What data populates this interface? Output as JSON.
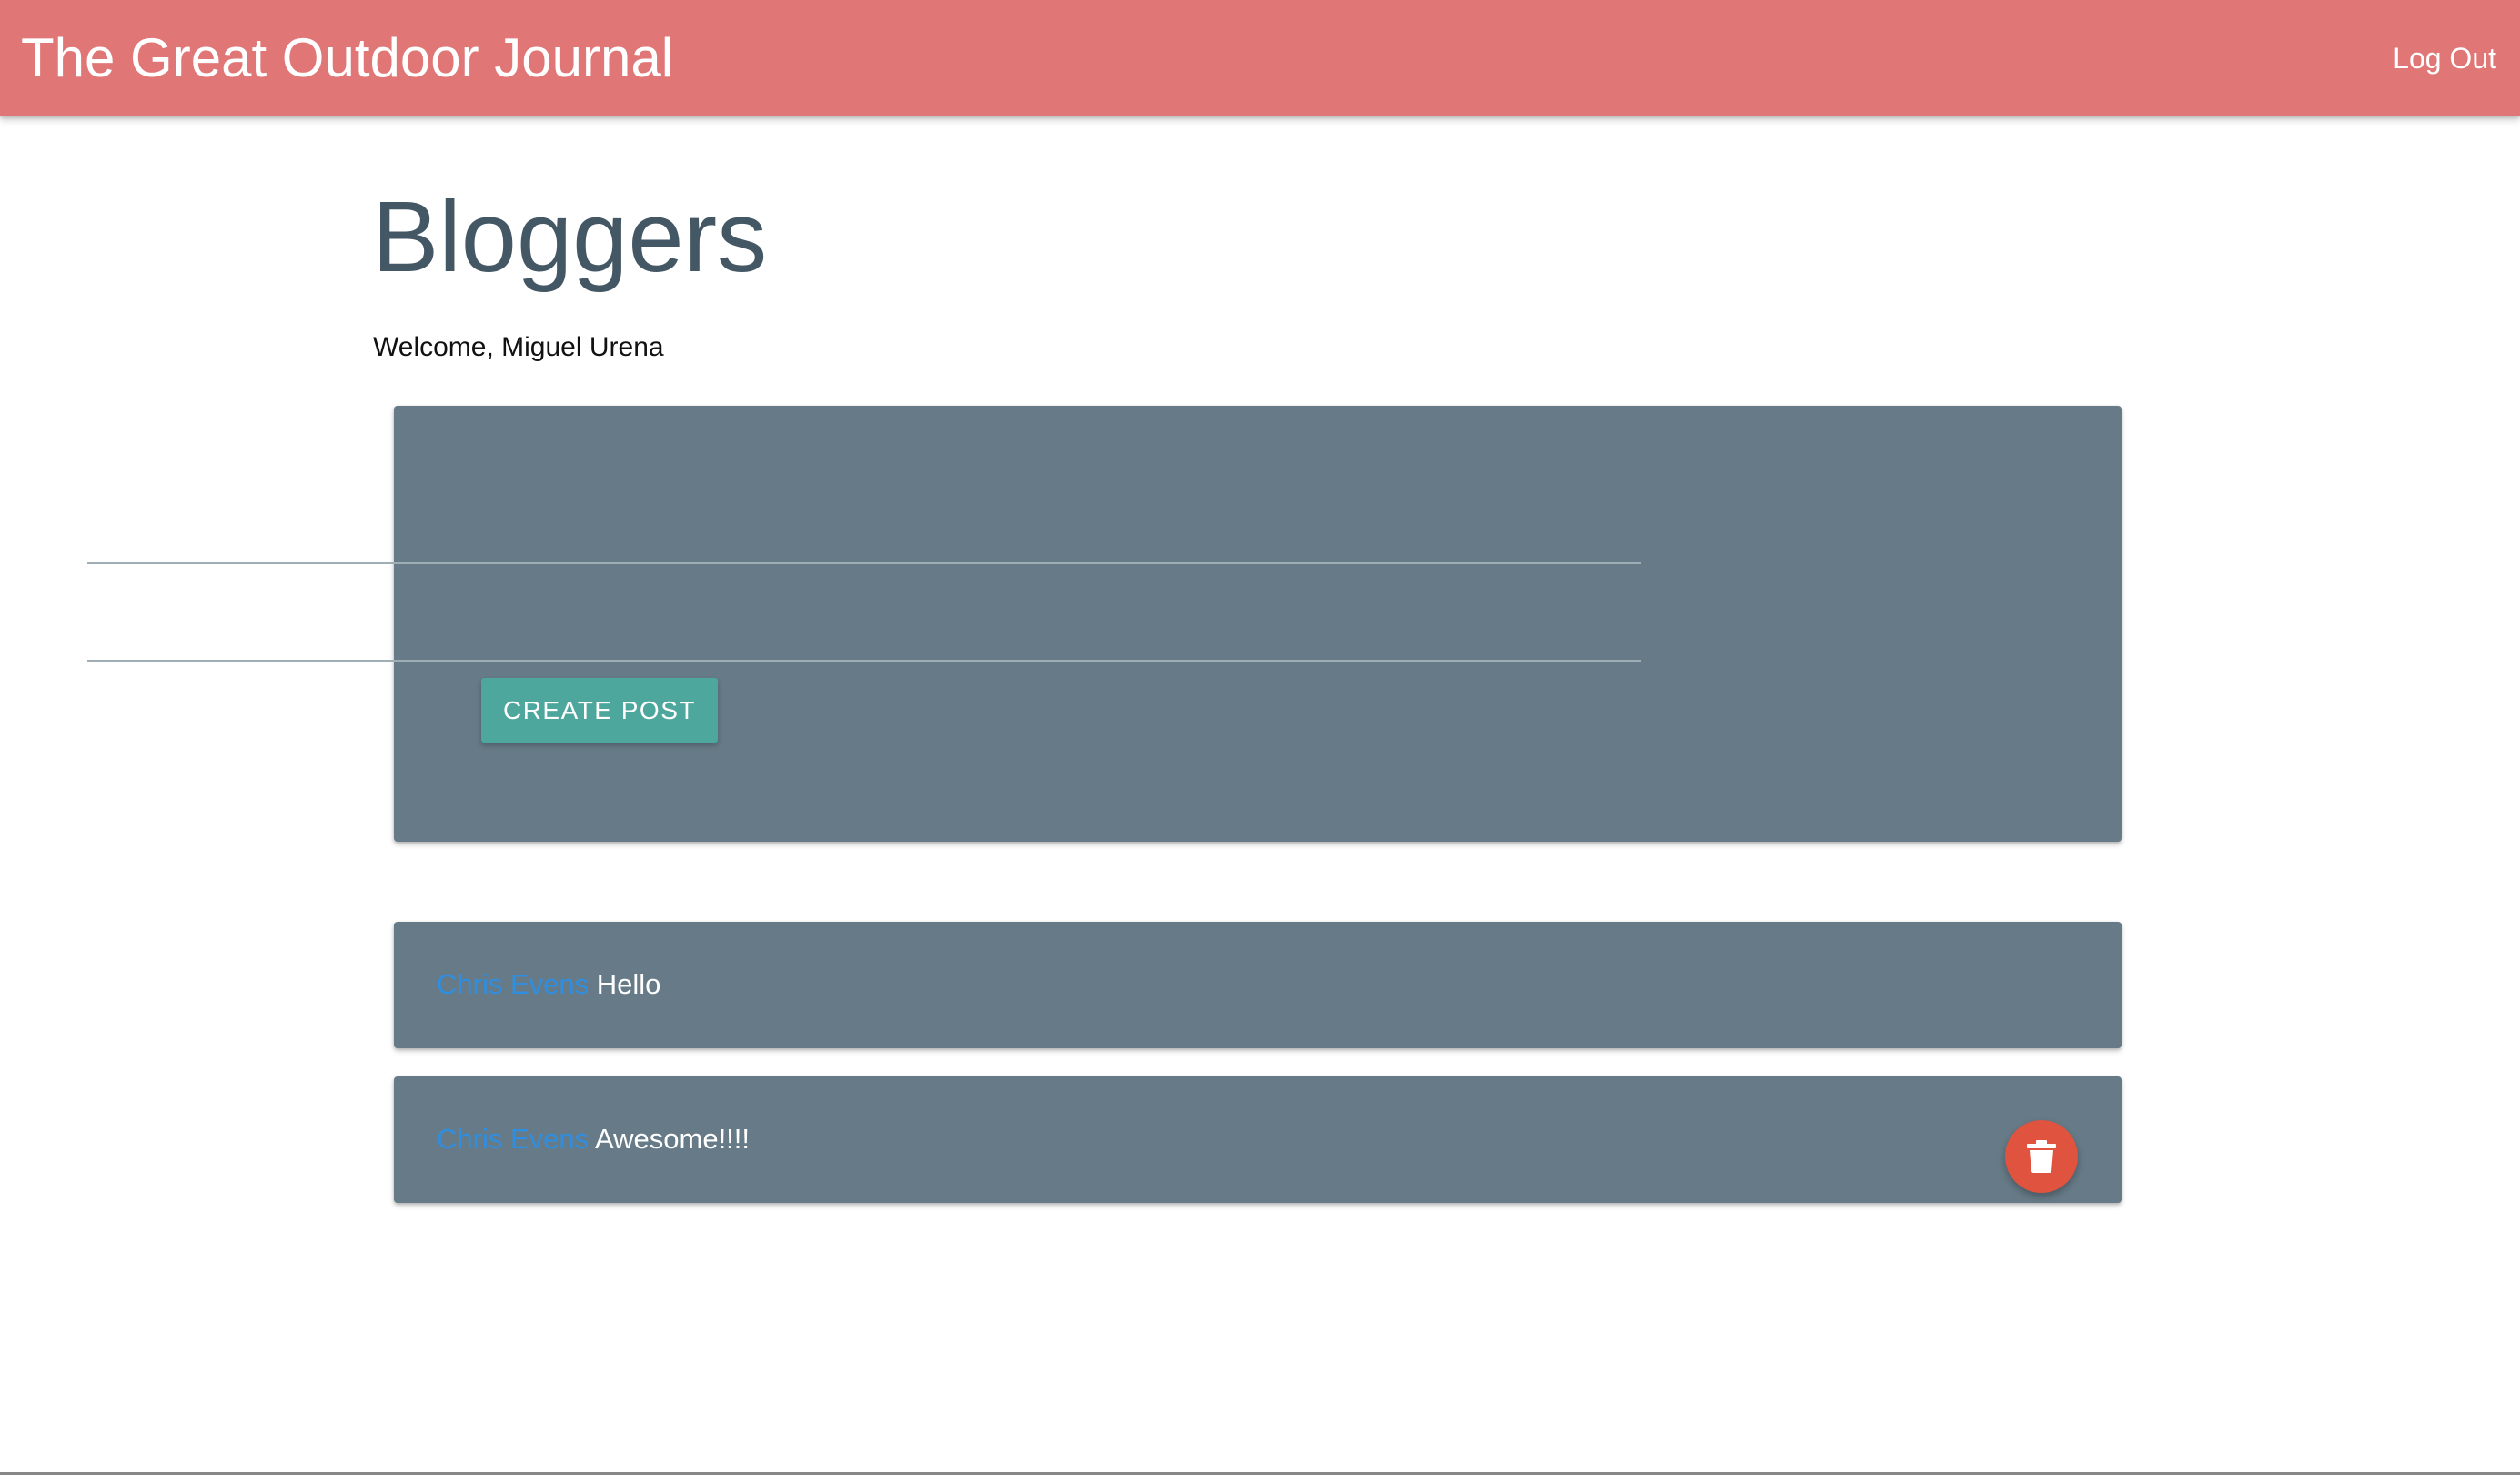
{
  "app": {
    "brand": "The Great Outdoor Journal",
    "logout_label": "Log Out"
  },
  "page": {
    "title": "Bloggers",
    "welcome": "Welcome, Miguel Urena"
  },
  "form": {
    "title_value": "",
    "body_value": "",
    "create_label": "CREATE POST"
  },
  "posts": [
    {
      "author": "Chris Evens",
      "text": "Hello",
      "can_delete": false
    },
    {
      "author": "Chris Evens",
      "text": "Awesome!!!!",
      "can_delete": true
    }
  ],
  "colors": {
    "navbar": "#e07676",
    "card": "#667b87",
    "button": "#4ea79c",
    "author_link": "#2f8ee0",
    "delete": "#e0533f"
  },
  "icons": {
    "delete": "trash-icon"
  }
}
